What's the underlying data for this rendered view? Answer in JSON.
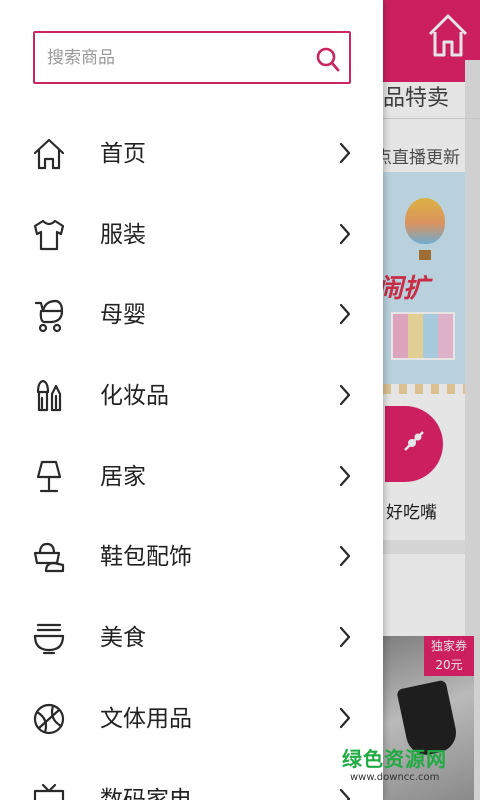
{
  "background": {
    "tab_title": "品特卖",
    "live_text": "点直播更新",
    "banner_text": "闹扩",
    "snack_label": "好吃嘴",
    "coupon": {
      "title": "独家券",
      "value": "20元"
    },
    "accent_color": "#e4236b"
  },
  "drawer": {
    "search": {
      "placeholder": "搜索商品",
      "value": ""
    },
    "menu_items": [
      {
        "label": "首页",
        "icon": "home-icon"
      },
      {
        "label": "服装",
        "icon": "tshirt-icon"
      },
      {
        "label": "母婴",
        "icon": "stroller-icon"
      },
      {
        "label": "化妆品",
        "icon": "makeup-brush-icon"
      },
      {
        "label": "居家",
        "icon": "lamp-icon"
      },
      {
        "label": "鞋包配饰",
        "icon": "shoe-bag-icon"
      },
      {
        "label": "美食",
        "icon": "noodle-bowl-icon"
      },
      {
        "label": "文体用品",
        "icon": "ball-icon"
      },
      {
        "label": "数码家电",
        "icon": "tv-icon"
      }
    ],
    "border_color": "#c9265f"
  },
  "watermark": {
    "title": "绿色资源网",
    "url": "www.downcc.com"
  }
}
